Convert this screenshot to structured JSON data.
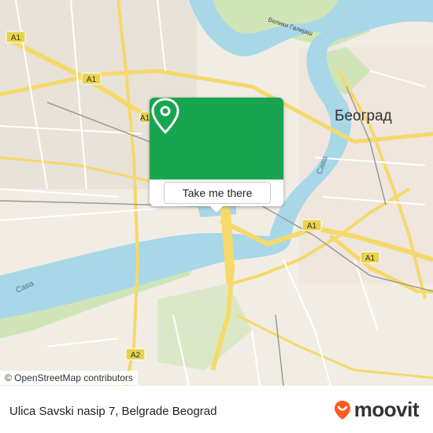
{
  "map": {
    "city_label": "Београд",
    "river_sava_left": "Сава",
    "river_sava_right": "Сава",
    "island_label": "Велики Галијаш",
    "road_badges": [
      "A1",
      "A1",
      "A1",
      "A1",
      "A1",
      "A2"
    ],
    "colors": {
      "water": "#a8d7e8",
      "land": "#f1ede4",
      "park": "#cfe4b7",
      "road_major": "#f5d96a",
      "road_minor": "#ffffff",
      "badge_bg": "#e7d24a"
    }
  },
  "popup": {
    "pin_icon": "location-pin-icon",
    "button_label": "Take me there"
  },
  "attribution": "© OpenStreetMap contributors",
  "footer": {
    "address": "Ulica Savski nasip 7, Belgrade Beograd",
    "brand_name": "moovit",
    "brand_color": "#ff5a1f"
  }
}
